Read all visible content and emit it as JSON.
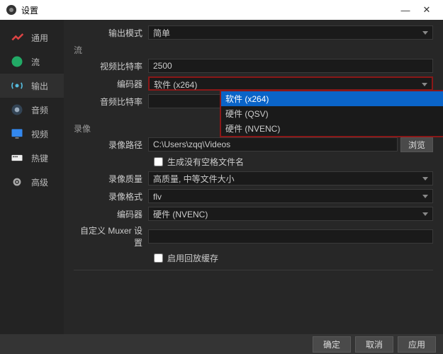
{
  "window": {
    "title": "设置",
    "minimize": "—",
    "close": "✕"
  },
  "sidebar": {
    "items": [
      {
        "label": "通用"
      },
      {
        "label": "流"
      },
      {
        "label": "输出"
      },
      {
        "label": "音频"
      },
      {
        "label": "视频"
      },
      {
        "label": "热键"
      },
      {
        "label": "高级"
      }
    ]
  },
  "output": {
    "mode_label": "输出模式",
    "mode_value": "简单",
    "stream_section": "流",
    "video_bitrate_label": "视频比特率",
    "video_bitrate_value": "2500",
    "encoder_label": "编码器",
    "encoder_value": "软件 (x264)",
    "encoder_options": [
      "软件 (x264)",
      "硬件 (QSV)",
      "硬件 (NVENC)"
    ],
    "audio_bitrate_label": "音频比特率",
    "recording_section": "录像",
    "rec_path_label": "录像路径",
    "rec_path_value": "C:\\Users\\zqq\\Videos",
    "browse_label": "浏览",
    "no_space_label": "生成没有空格文件名",
    "rec_quality_label": "录像质量",
    "rec_quality_value": "高质量, 中等文件大小",
    "rec_format_label": "录像格式",
    "rec_format_value": "flv",
    "rec_encoder_label": "编码器",
    "rec_encoder_value": "硬件 (NVENC)",
    "muxer_label": "自定义 Muxer 设置",
    "replay_buffer_label": "启用回放缓存"
  },
  "footer": {
    "ok": "确定",
    "cancel": "取消",
    "apply": "应用"
  }
}
